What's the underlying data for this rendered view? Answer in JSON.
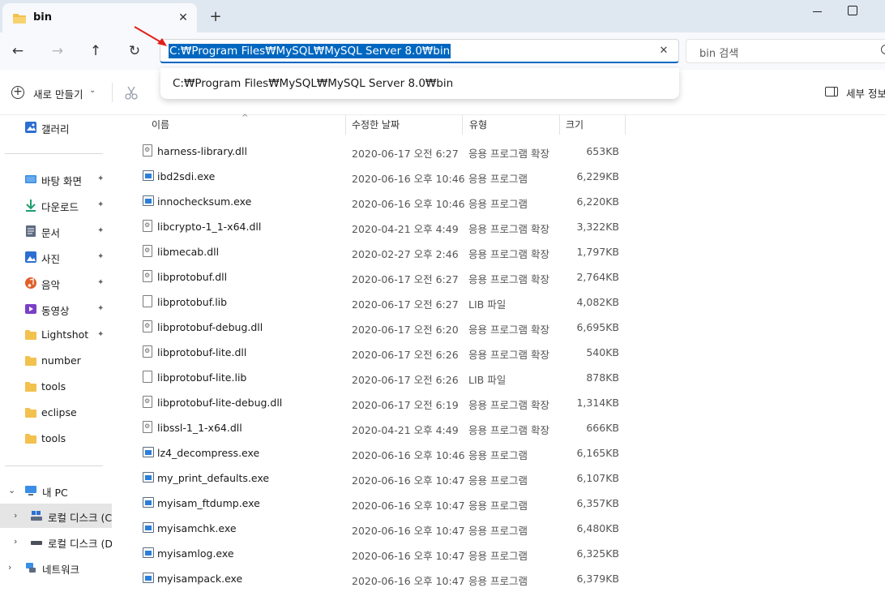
{
  "tab": {
    "title": "bin",
    "close_glyph": "✕",
    "add_glyph": "+"
  },
  "nav": {
    "back": "←",
    "forward": "→",
    "up": "↑",
    "refresh": "↻"
  },
  "address": {
    "path": "C:₩Program Files₩MySQL₩MySQL Server 8.0₩bin",
    "clear_glyph": "✕"
  },
  "suggestion": {
    "path": "C:₩Program Files₩MySQL₩MySQL Server 8.0₩bin"
  },
  "search": {
    "placeholder": "bin 검색"
  },
  "command_bar": {
    "new_label": "새로 만들기",
    "new_chevron": "⌄",
    "details_label": "세부 정보"
  },
  "sidebar": {
    "gallery": "갤러리",
    "quick_access": [
      {
        "label": "바탕 화면",
        "icon": "desktop-icon",
        "pinned": true
      },
      {
        "label": "다운로드",
        "icon": "download-icon",
        "pinned": true
      },
      {
        "label": "문서",
        "icon": "document-icon",
        "pinned": true
      },
      {
        "label": "사진",
        "icon": "pictures-icon",
        "pinned": true
      },
      {
        "label": "음악",
        "icon": "music-icon",
        "pinned": true
      },
      {
        "label": "동영상",
        "icon": "videos-icon",
        "pinned": true
      },
      {
        "label": "Lightshot",
        "icon": "folder-icon",
        "pinned": true
      },
      {
        "label": "number",
        "icon": "folder-icon",
        "pinned": false
      },
      {
        "label": "tools",
        "icon": "folder-icon",
        "pinned": false
      },
      {
        "label": "eclipse",
        "icon": "folder-icon",
        "pinned": false
      },
      {
        "label": "tools",
        "icon": "folder-icon",
        "pinned": false
      }
    ],
    "pin_glyph": "📌",
    "this_pc": "내 PC",
    "local_disk_c": "로컬 디스크 (C",
    "local_disk_d": "로컬 디스크 (D",
    "network": "네트워크",
    "chevron_down": "⌄",
    "chevron_right": "›"
  },
  "columns": {
    "name": "이름",
    "modified": "수정한 날짜",
    "type": "유형",
    "size": "크기",
    "sort_glyph": "^"
  },
  "files": [
    {
      "name": "harness-library.dll",
      "date": "2020-06-17 오전 6:27",
      "type": "응용 프로그램 확장",
      "size": "653KB",
      "kind": "dll"
    },
    {
      "name": "ibd2sdi.exe",
      "date": "2020-06-16 오후 10:46",
      "type": "응용 프로그램",
      "size": "6,229KB",
      "kind": "exe"
    },
    {
      "name": "innochecksum.exe",
      "date": "2020-06-16 오후 10:46",
      "type": "응용 프로그램",
      "size": "6,220KB",
      "kind": "exe"
    },
    {
      "name": "libcrypto-1_1-x64.dll",
      "date": "2020-04-21 오후 4:49",
      "type": "응용 프로그램 확장",
      "size": "3,322KB",
      "kind": "dll"
    },
    {
      "name": "libmecab.dll",
      "date": "2020-02-27 오후 2:46",
      "type": "응용 프로그램 확장",
      "size": "1,797KB",
      "kind": "dll"
    },
    {
      "name": "libprotobuf.dll",
      "date": "2020-06-17 오전 6:27",
      "type": "응용 프로그램 확장",
      "size": "2,764KB",
      "kind": "dll"
    },
    {
      "name": "libprotobuf.lib",
      "date": "2020-06-17 오전 6:27",
      "type": "LIB 파일",
      "size": "4,082KB",
      "kind": "lib"
    },
    {
      "name": "libprotobuf-debug.dll",
      "date": "2020-06-17 오전 6:20",
      "type": "응용 프로그램 확장",
      "size": "6,695KB",
      "kind": "dll"
    },
    {
      "name": "libprotobuf-lite.dll",
      "date": "2020-06-17 오전 6:26",
      "type": "응용 프로그램 확장",
      "size": "540KB",
      "kind": "dll"
    },
    {
      "name": "libprotobuf-lite.lib",
      "date": "2020-06-17 오전 6:26",
      "type": "LIB 파일",
      "size": "878KB",
      "kind": "lib"
    },
    {
      "name": "libprotobuf-lite-debug.dll",
      "date": "2020-06-17 오전 6:19",
      "type": "응용 프로그램 확장",
      "size": "1,314KB",
      "kind": "dll"
    },
    {
      "name": "libssl-1_1-x64.dll",
      "date": "2020-04-21 오후 4:49",
      "type": "응용 프로그램 확장",
      "size": "666KB",
      "kind": "dll"
    },
    {
      "name": "lz4_decompress.exe",
      "date": "2020-06-16 오후 10:46",
      "type": "응용 프로그램",
      "size": "6,165KB",
      "kind": "exe"
    },
    {
      "name": "my_print_defaults.exe",
      "date": "2020-06-16 오후 10:47",
      "type": "응용 프로그램",
      "size": "6,107KB",
      "kind": "exe"
    },
    {
      "name": "myisam_ftdump.exe",
      "date": "2020-06-16 오후 10:47",
      "type": "응용 프로그램",
      "size": "6,357KB",
      "kind": "exe"
    },
    {
      "name": "myisamchk.exe",
      "date": "2020-06-16 오후 10:47",
      "type": "응용 프로그램",
      "size": "6,480KB",
      "kind": "exe"
    },
    {
      "name": "myisamlog.exe",
      "date": "2020-06-16 오후 10:47",
      "type": "응용 프로그램",
      "size": "6,325KB",
      "kind": "exe"
    },
    {
      "name": "myisampack.exe",
      "date": "2020-06-16 오후 10:47",
      "type": "응용 프로그램",
      "size": "6,379KB",
      "kind": "exe"
    }
  ],
  "colors": {
    "accent": "#0067c0",
    "folder": "#f2c14e",
    "annotation": "#e0201b"
  }
}
